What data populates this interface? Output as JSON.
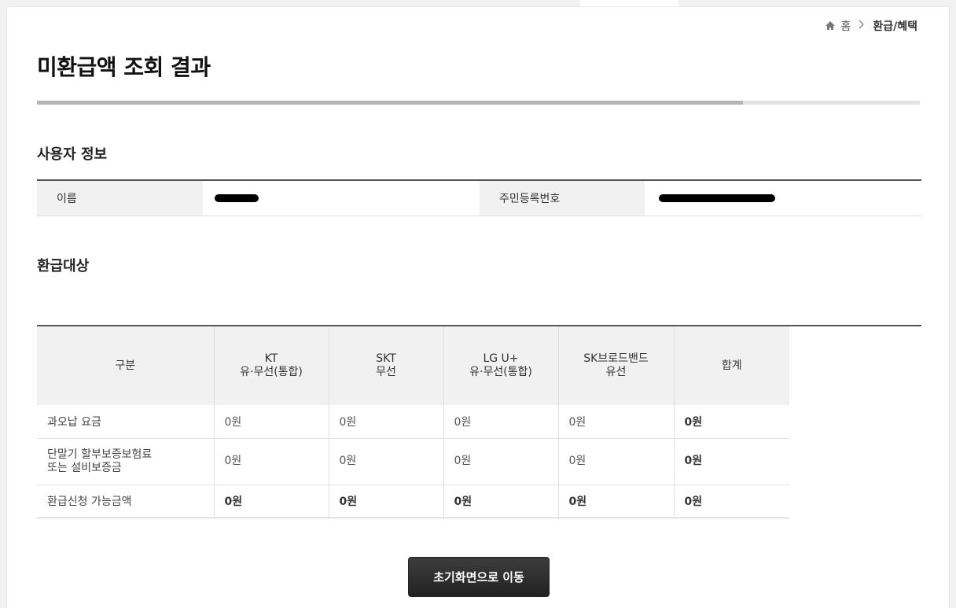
{
  "breadcrumb": {
    "home": "홈",
    "current": "환급/혜택"
  },
  "page_title": "미환급액 조회 결과",
  "progress": {
    "value_percent": 80
  },
  "user_section": {
    "title": "사용자 정보",
    "name_label": "이름",
    "rrn_label": "주민등록번호"
  },
  "refund_section": {
    "title": "환급대상",
    "headers": [
      "구분",
      "KT\n유·무선(통합)",
      "SKT\n무선",
      "LG U+\n유·무선(통합)",
      "SK브로드밴드\n유선",
      "합계"
    ],
    "rows": [
      {
        "label": "과오납 요금",
        "values": [
          "0원",
          "0원",
          "0원",
          "0원",
          "0원"
        ]
      },
      {
        "label": "단말기 할부보증보험료\n또는 설비보증금",
        "values": [
          "0원",
          "0원",
          "0원",
          "0원",
          "0원"
        ]
      },
      {
        "label": "환급신청 가능금액",
        "values": [
          "0원",
          "0원",
          "0원",
          "0원",
          "0원"
        ]
      }
    ]
  },
  "buttons": {
    "go_home": "초기화면으로 이동"
  },
  "icons": {
    "home": "home-icon",
    "separator": "chevron-right-icon"
  },
  "colors": {
    "button_bg": "#2d2d2d",
    "header_bg": "#f1f1f1"
  }
}
